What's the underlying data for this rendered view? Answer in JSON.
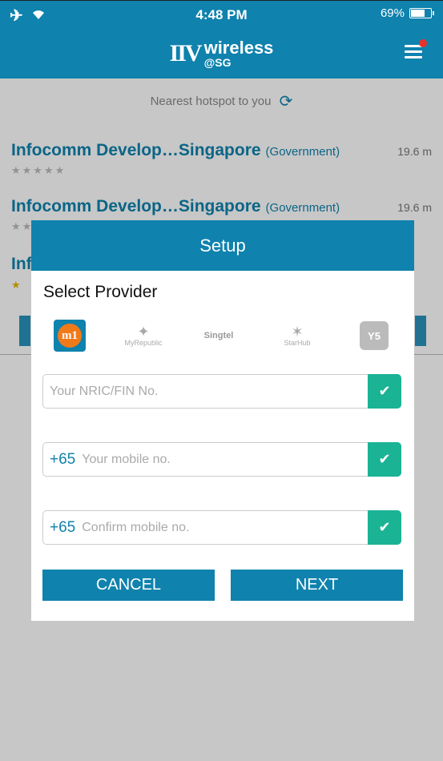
{
  "status_bar": {
    "time": "4:48 PM",
    "battery": "69%"
  },
  "header": {
    "logo_mark": "IIV",
    "logo_line1": "wireless",
    "logo_line2": "@SG"
  },
  "background": {
    "nearest_text": "Nearest hotspot to you",
    "hotspots": [
      {
        "name": "Infocomm Develop…Singapore",
        "type": "(Government)",
        "distance": "19.6 m"
      },
      {
        "name": "Infocomm Develop…Singapore",
        "type": "(Government)",
        "distance": "19.6 m"
      },
      {
        "name": "Inf",
        "type": "",
        "distance": ""
      }
    ],
    "stars": "★★★★★",
    "star_single": "★"
  },
  "dialog": {
    "title": "Setup",
    "select_label": "Select Provider",
    "providers": [
      {
        "id": "m1",
        "label": "m1"
      },
      {
        "id": "myrepublic",
        "label": "MyRepublic"
      },
      {
        "id": "singtel",
        "label": "Singtel"
      },
      {
        "id": "starhub",
        "label": "StarHub"
      },
      {
        "id": "y5",
        "label": "Y5"
      }
    ],
    "nric_placeholder": "Your NRIC/FIN No.",
    "mobile_prefix": "+65",
    "mobile_placeholder": "Your mobile no.",
    "confirm_prefix": "+65",
    "confirm_placeholder": "Confirm mobile no.",
    "cancel_label": "CANCEL",
    "next_label": "NEXT"
  }
}
